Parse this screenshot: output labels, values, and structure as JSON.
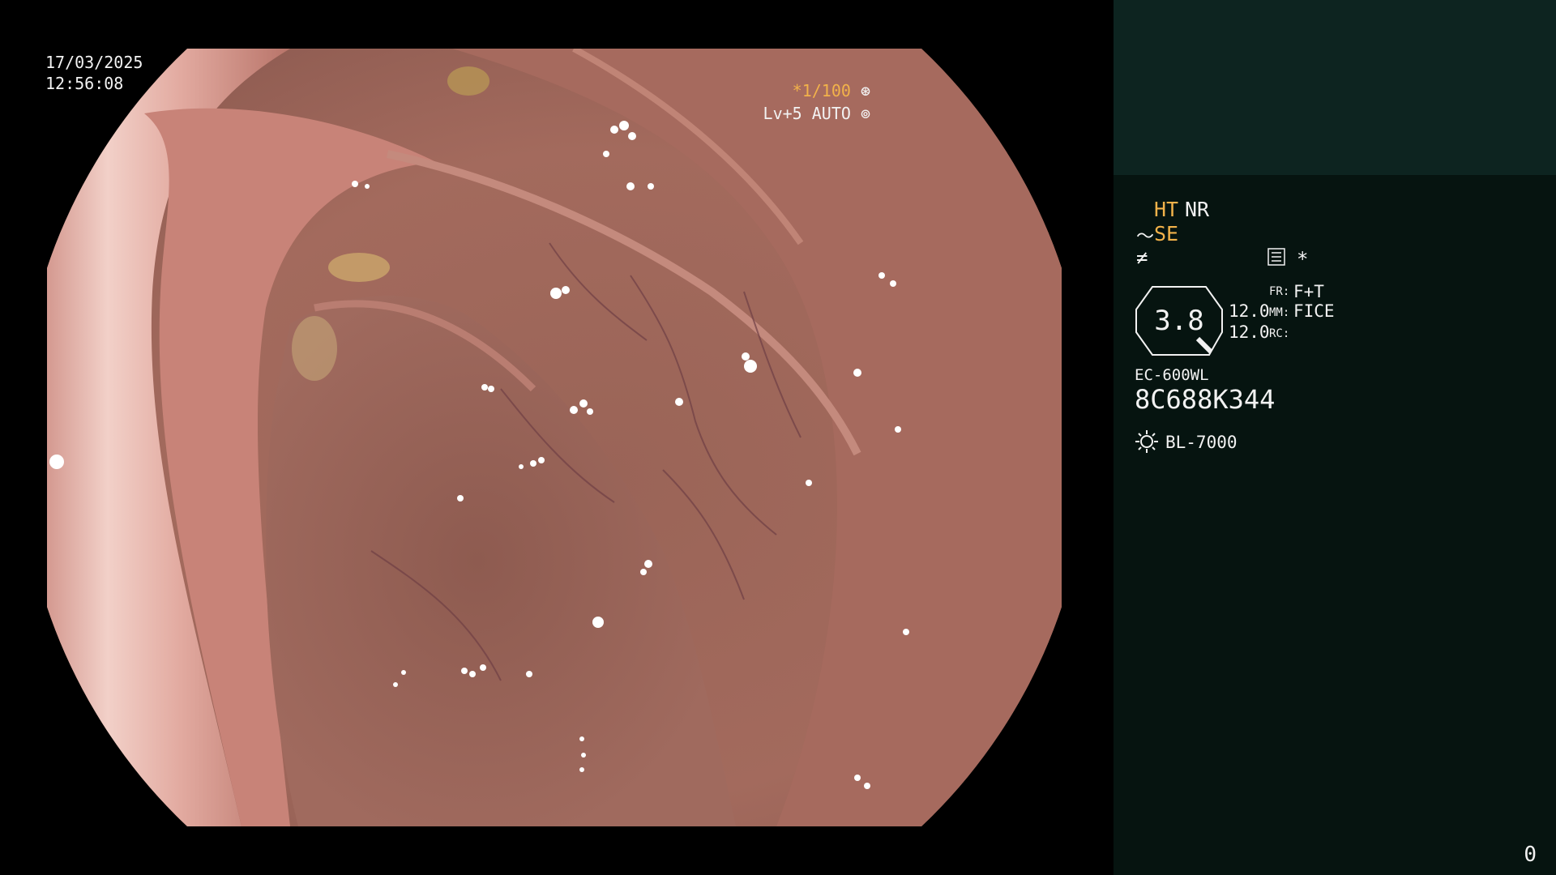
{
  "overlay": {
    "date": "17/03/2025",
    "time": "12:56:08",
    "shutter": "*1/100",
    "shutter_icon": "shutter-icon",
    "level": "Lv+5 AUTO",
    "level_icon": "iris-icon"
  },
  "panel": {
    "ht": "HT",
    "nr": "NR",
    "se_icon": "wave-icon",
    "se": "SE",
    "slash_icon": "structure-icon",
    "menu_icon": "menu-icon",
    "star": "*",
    "zoom": "3.8",
    "val1": "12.0",
    "val2": "12.0",
    "fr_label": "FR:",
    "fr_value": "F+T",
    "mm_label": "MM:",
    "mm_value": "FICE",
    "rc_label": "RC:",
    "scope_model": "EC-600WL",
    "scope_serial": "8C688K344",
    "light_icon": "sun-icon",
    "light_model": "BL-7000"
  },
  "counter": "0",
  "colors": {
    "amber": "#f2b24a",
    "panel_top": "#0d2420",
    "panel": "#061410",
    "mucosa": "#a86a5f"
  }
}
